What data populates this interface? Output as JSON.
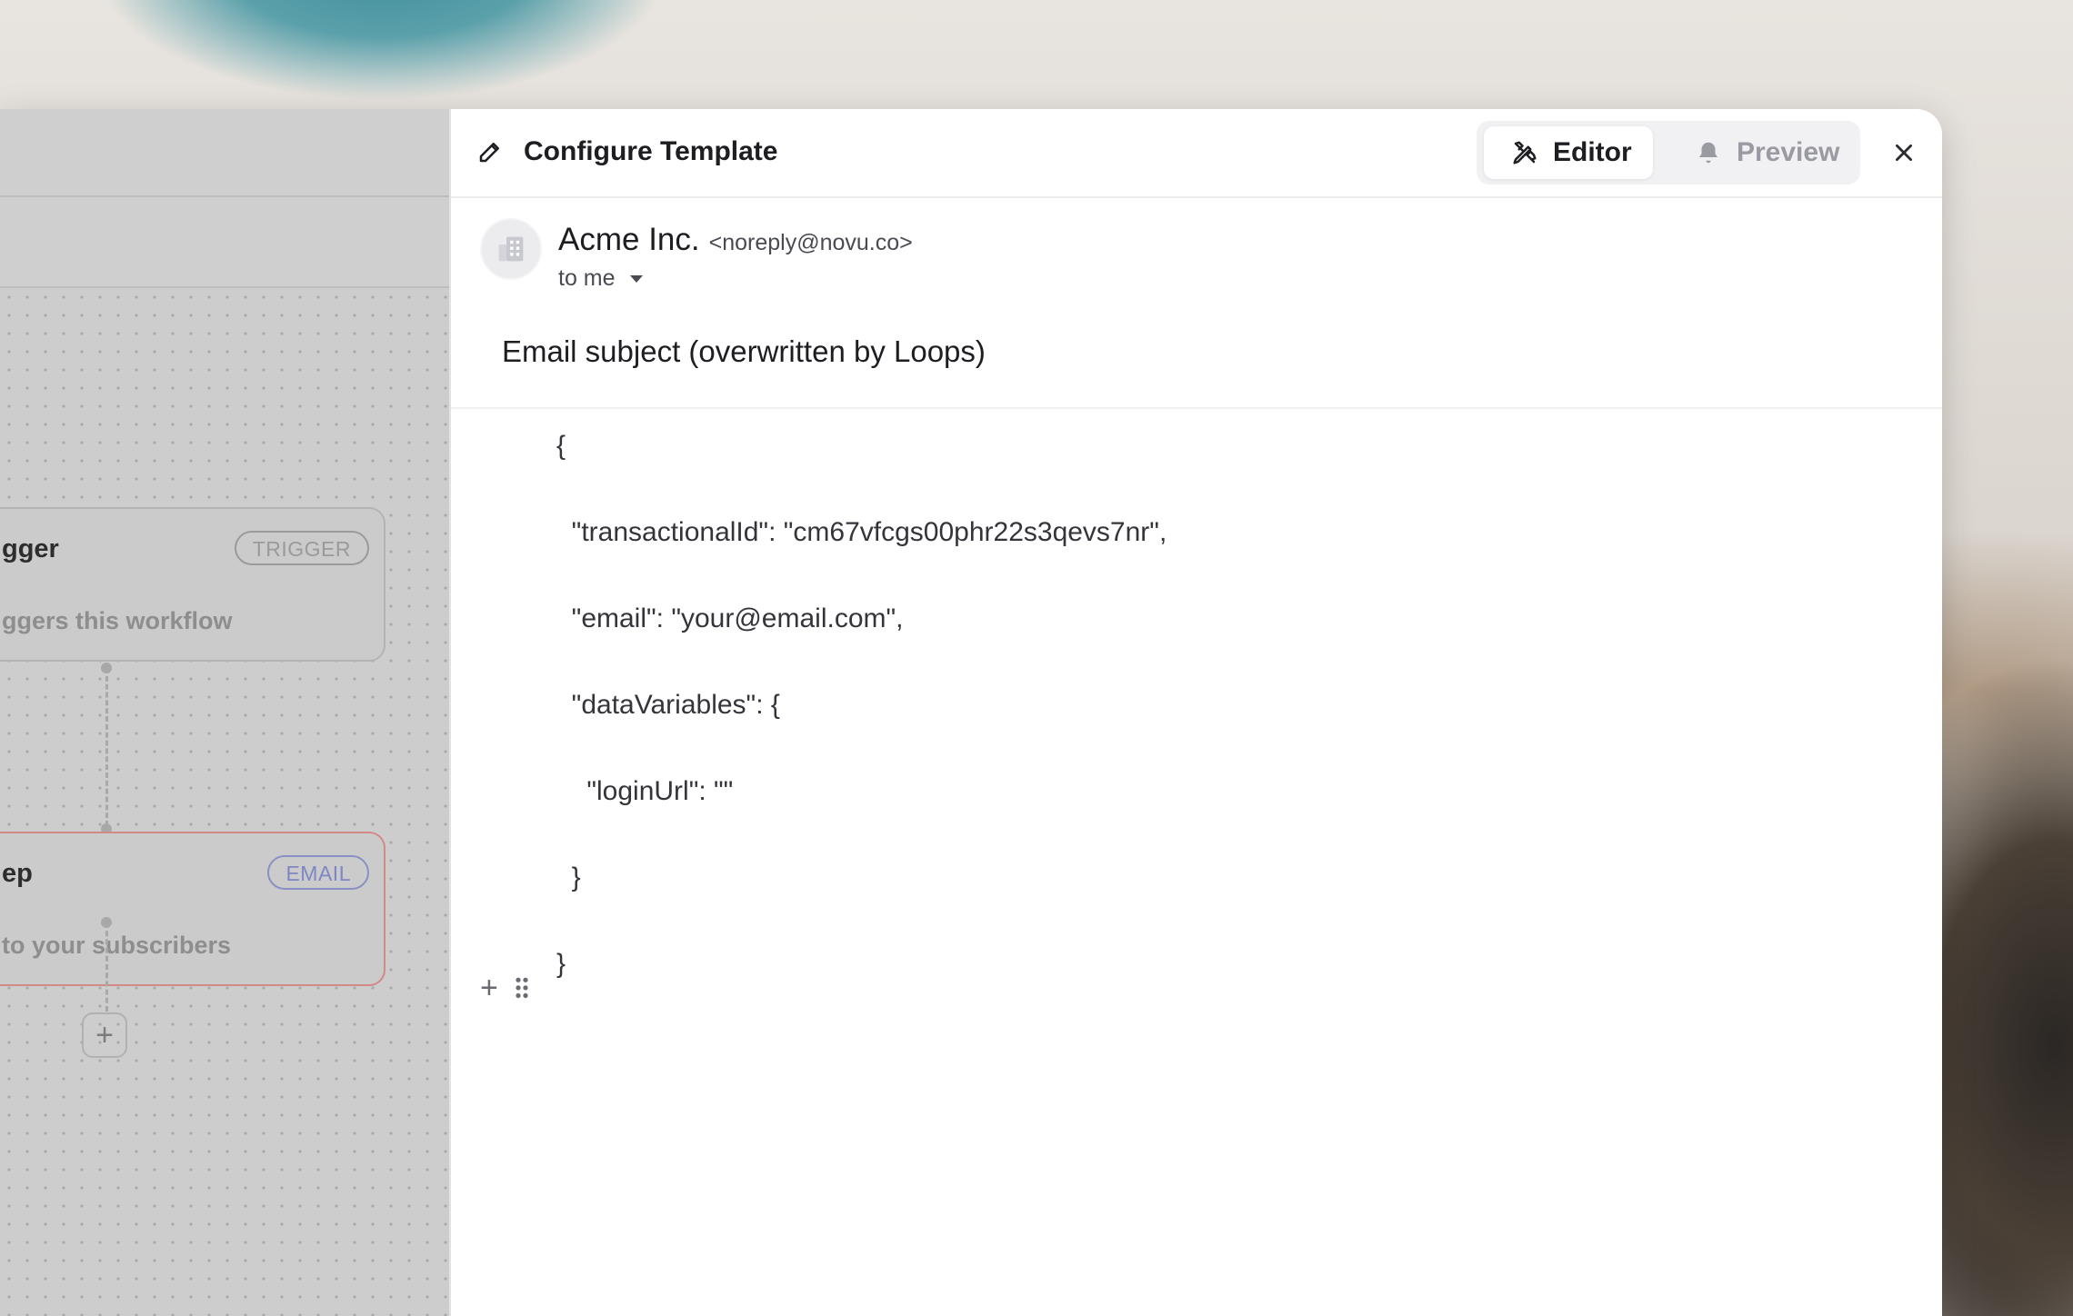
{
  "workflow": {
    "trigger_node": {
      "title": "gger",
      "badge": "TRIGGER",
      "description": "ggers this workflow"
    },
    "email_node": {
      "title": "ep",
      "badge": "EMAIL",
      "description": "to your subscribers"
    },
    "add_step_symbol": "+"
  },
  "drawer": {
    "title": "Configure Template",
    "tabs": {
      "editor": "Editor",
      "preview": "Preview",
      "active": "editor"
    }
  },
  "email": {
    "sender_name": "Acme Inc.",
    "sender_email": "<noreply@novu.co>",
    "recipient": "to me",
    "subject": "Email subject (overwritten by Loops)",
    "body_lines": [
      "{",
      "  \"transactionalId\": \"cm67vfcgs00phr22s3qevs7nr\",",
      "  \"email\": \"your@email.com\",",
      "  \"dataVariables\": {",
      "    \"loginUrl\": \"\"",
      "  }",
      "}"
    ]
  },
  "colors": {
    "email_node_border": "#d38a86",
    "email_badge": "#7e86c4",
    "text_primary": "#1d1d22",
    "text_muted": "#9a9aa3"
  }
}
